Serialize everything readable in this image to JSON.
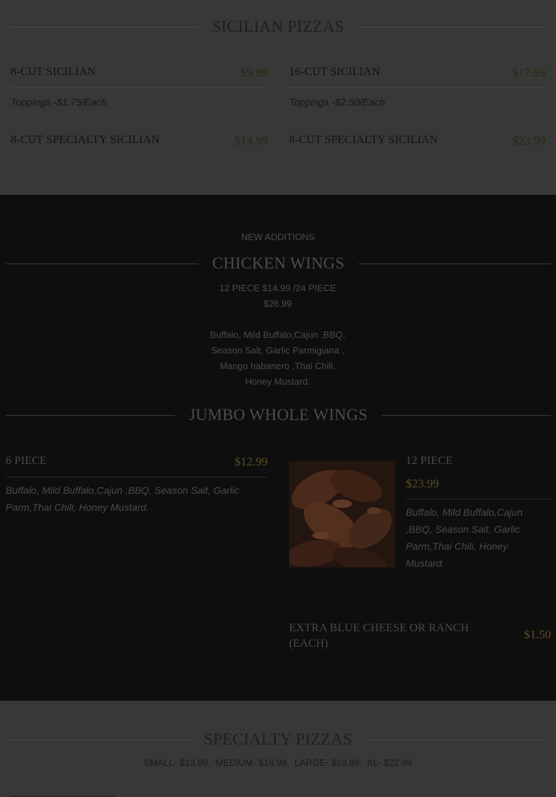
{
  "sicilian": {
    "title": "SICILIAN PIZZAS",
    "items": [
      {
        "name": "8-CUT SICILIAN",
        "price": "$9.99",
        "desc": "Toppings -$1.75/Each"
      },
      {
        "name": "16-CUT SICILIAN",
        "price": "$17.99",
        "desc": "Toppings -$2.50/Each"
      },
      {
        "name": "8-CUT SPECIALTY SICILIAN",
        "price": "$14.99"
      },
      {
        "name": "8-CUT SPECIALTY SICILIAN",
        "price": "$23.99"
      }
    ]
  },
  "wings": {
    "kicker": "NEW ADDITIONS",
    "title": "CHICKEN WINGS",
    "pricing": "12 PIECE $14.99 /24 PIECE $26.99",
    "flavors": "Buffalo, Mild Buffalo,Cajun ,BBQ, Season Salt, Garlic Parmigiana , Mango habanero ,Thai Chili, Honey Mustard.",
    "jumbo_title": "JUMBO WHOLE WINGS",
    "jumbo_items": [
      {
        "name": "6 PIECE",
        "price": "$12.99",
        "desc": "Buffalo, Mild Buffalo,Cajun ,BBQ, Season Salt, Garlic Parm,Thai Chili, Honey Mustard."
      },
      {
        "name": "12 PIECE",
        "price": "$23.99",
        "desc": "Buffalo, Mild Buffalo,Cajun ,BBQ, Season Salt, Garlic Parm,Thai Chili, Honey Mustard."
      }
    ],
    "extra": {
      "name": "EXTRA BLUE CHEESE OR RANCH (EACH)",
      "price": "$1.50"
    }
  },
  "specialty": {
    "title": "SPECIALTY PIZZAS",
    "sizes": "SMALL- $13.99,  MEDIUM- $16.99,  LARGE- $19.99,  XL- $22.99"
  }
}
